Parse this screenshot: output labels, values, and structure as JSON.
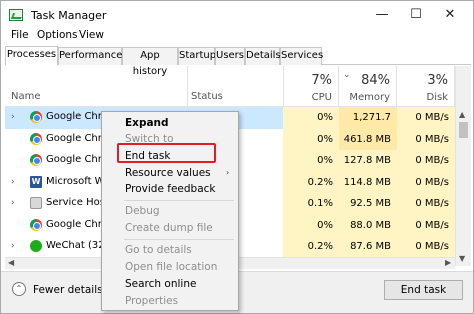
{
  "window": {
    "title": "Task Manager",
    "controls": {
      "minimize": "—",
      "maximize": "☐",
      "close": "✕"
    }
  },
  "menu": [
    "File",
    "Options",
    "View"
  ],
  "tabs": [
    "Processes",
    "Performance",
    "App history",
    "Startup",
    "Users",
    "Details",
    "Services"
  ],
  "active_tab": "Processes",
  "header": {
    "name": "Name",
    "status": "Status",
    "cpu_pct": "7%",
    "cpu": "CPU",
    "mem_pct": "84%",
    "mem": "Memory",
    "disk_pct": "3%",
    "disk": "Disk",
    "sort_indicator": "⌄"
  },
  "rows": [
    {
      "name": "Google Chrome",
      "expand": "›",
      "icon": "chrome-icon",
      "cpu": "0%",
      "mem": "1,271.7 MB",
      "disk": "0 MB/s",
      "selected": true
    },
    {
      "name": "Google Chrome",
      "expand": "",
      "icon": "chrome-icon",
      "cpu": "0%",
      "mem": "461.8 MB",
      "disk": "0 MB/s"
    },
    {
      "name": "Google Chrome",
      "expand": "",
      "icon": "chrome-icon",
      "cpu": "0%",
      "mem": "127.8 MB",
      "disk": "0 MB/s"
    },
    {
      "name": "Microsoft Word",
      "expand": "›",
      "icon": "word-icon",
      "cpu": "0.2%",
      "mem": "114.8 MB",
      "disk": "0 MB/s"
    },
    {
      "name": "Service Host:",
      "expand": "›",
      "icon": "gear-icon",
      "cpu": "0.1%",
      "mem": "92.5 MB",
      "disk": "0 MB/s"
    },
    {
      "name": "Google Chrome",
      "expand": "",
      "icon": "chrome-icon",
      "cpu": "0%",
      "mem": "88.0 MB",
      "disk": "0 MB/s"
    },
    {
      "name": "WeChat (32 b",
      "expand": "›",
      "icon": "wechat-icon",
      "cpu": "0.2%",
      "mem": "87.6 MB",
      "disk": "0 MB/s"
    }
  ],
  "context_menu": {
    "expand": "Expand",
    "switch_to": "Switch to",
    "end_task": "End task",
    "resource_values": "Resource values",
    "provide_feedback": "Provide feedback",
    "debug": "Debug",
    "create_dump": "Create dump file",
    "go_to_details": "Go to details",
    "open_file_location": "Open file location",
    "search_online": "Search online",
    "properties": "Properties",
    "submenu_arrow": "›"
  },
  "footer": {
    "fewer_details": "Fewer details",
    "end_task_button": "End task"
  },
  "colors": {
    "selection": "#cce8ff",
    "heat_light": "#fff4c4",
    "heat_mid": "#ffe9a8",
    "highlight_box": "#e02020"
  }
}
